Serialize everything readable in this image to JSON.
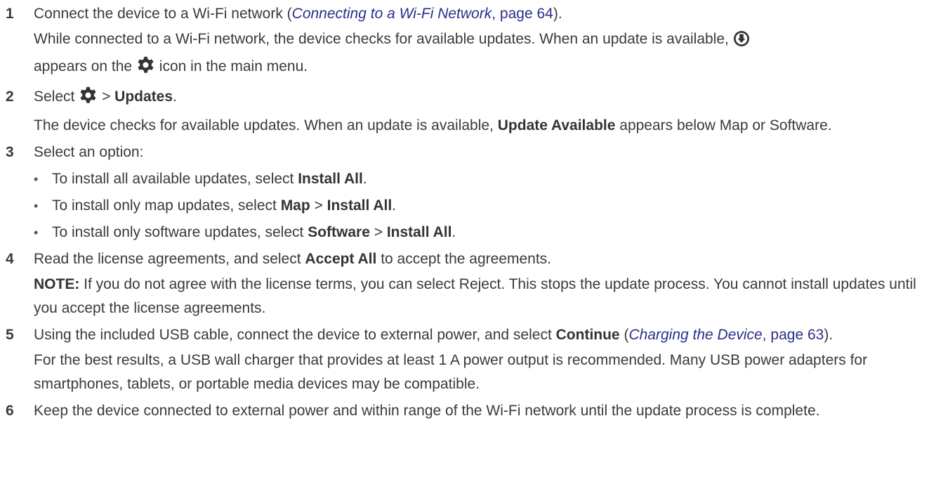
{
  "steps": [
    {
      "num": "1",
      "text_a": "Connect the device to a Wi-Fi network (",
      "xref_title": "Connecting to a Wi-Fi Network",
      "xref_page": ", page 64",
      "text_b": ").",
      "para_a": "While connected to a Wi-Fi network, the device checks for available updates. When an update is available,",
      "para_b": "appears on the",
      "para_c": "icon in the main menu."
    },
    {
      "num": "2",
      "text_a": "Select",
      "sep": ">",
      "bold": "Updates",
      "text_b": ".",
      "para_a": "The device checks for available updates. When an update is available,",
      "para_bold": "Update Available",
      "para_b": "appears below Map or Software."
    },
    {
      "num": "3",
      "text": "Select an option:",
      "bullets": [
        {
          "a": "To install all available updates, select",
          "b1": "Install All",
          "sep": "",
          "b2": "",
          "end": "."
        },
        {
          "a": "To install only map updates, select",
          "b1": "Map",
          "sep": ">",
          "b2": "Install All",
          "end": "."
        },
        {
          "a": "To install only software updates, select",
          "b1": "Software",
          "sep": ">",
          "b2": "Install All",
          "end": "."
        }
      ]
    },
    {
      "num": "4",
      "text_a": "Read the license agreements, and select",
      "bold": "Accept All",
      "text_b": "to accept the agreements.",
      "note_label": "NOTE:",
      "note_text": "If you do not agree with the license terms, you can select Reject. This stops the update process. You cannot install updates until you accept the license agreements."
    },
    {
      "num": "5",
      "text_a": "Using the included USB cable, connect the device to external power, and select",
      "bold": "Continue",
      "text_b": "(",
      "xref_title": "Charging the Device",
      "xref_page": ", page 63",
      "text_c": ").",
      "para": "For the best results, a USB wall charger that provides at least 1 A power output is recommended. Many USB power adapters for smartphones, tablets, or portable media devices may be compatible."
    },
    {
      "num": "6",
      "text": "Keep the device connected to external power and within range of the Wi-Fi network until the update process is complete."
    }
  ],
  "icons": {
    "update": "download-circle-icon",
    "settings": "gear-icon"
  },
  "colors": {
    "text": "#3a3a3a",
    "link": "#2b2f8a"
  }
}
